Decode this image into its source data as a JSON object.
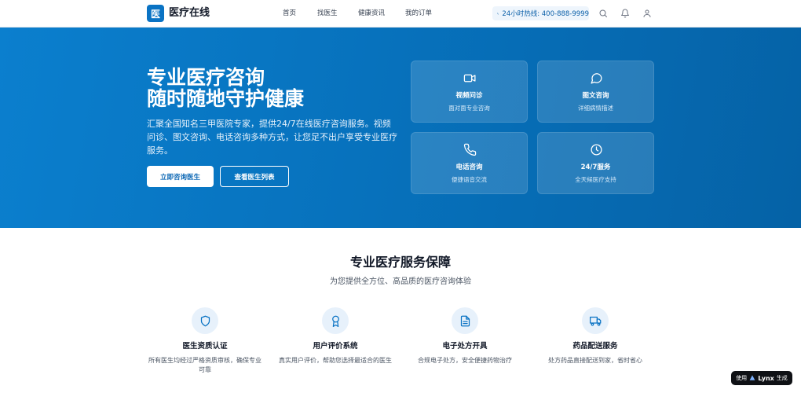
{
  "header": {
    "logo_char": "医",
    "brand": "医疗在线",
    "nav": [
      "首页",
      "找医生",
      "健康资讯",
      "我的订单"
    ],
    "hotline": "24小时热线: 400-888-9999",
    "icons": [
      "search-icon",
      "bell-icon",
      "user-icon"
    ]
  },
  "hero": {
    "title_line1": "专业医疗咨询",
    "title_line2": "随时随地守护健康",
    "description": "汇聚全国知名三甲医院专家，提供24/7在线医疗咨询服务。视频问诊、图文咨询、电话咨询多种方式，让您足不出户享受专业医疗服务。",
    "primary_button": "立即咨询医生",
    "secondary_button": "查看医生列表",
    "services": [
      {
        "title": "视频问诊",
        "desc": "面对面专业咨询",
        "icon": "video-icon"
      },
      {
        "title": "图文咨询",
        "desc": "详细病情描述",
        "icon": "chat-icon"
      },
      {
        "title": "电话咨询",
        "desc": "便捷语音交流",
        "icon": "phone-icon"
      },
      {
        "title": "24/7服务",
        "desc": "全天候医疗支持",
        "icon": "clock-icon"
      }
    ]
  },
  "features": {
    "title": "专业医疗服务保障",
    "subtitle": "为您提供全方位、高品质的医疗咨询体验",
    "items": [
      {
        "title": "医生资质认证",
        "desc": "所有医生均经过严格资质审核，确保专业可靠",
        "icon": "shield-icon"
      },
      {
        "title": "用户评价系统",
        "desc": "真实用户评价，帮助您选择最适合的医生",
        "icon": "award-icon"
      },
      {
        "title": "电子处方开具",
        "desc": "合规电子处方，安全便捷药物治疗",
        "icon": "document-icon"
      },
      {
        "title": "药品配送服务",
        "desc": "处方药品直接配送到家，省时省心",
        "icon": "truck-icon"
      }
    ]
  },
  "badge": {
    "prefix": "使用",
    "brand": "Lynx",
    "suffix": "生成"
  },
  "colors": {
    "primary": "#0a73c4",
    "hero_start": "#0b7fce",
    "hero_end": "#0562a6"
  }
}
